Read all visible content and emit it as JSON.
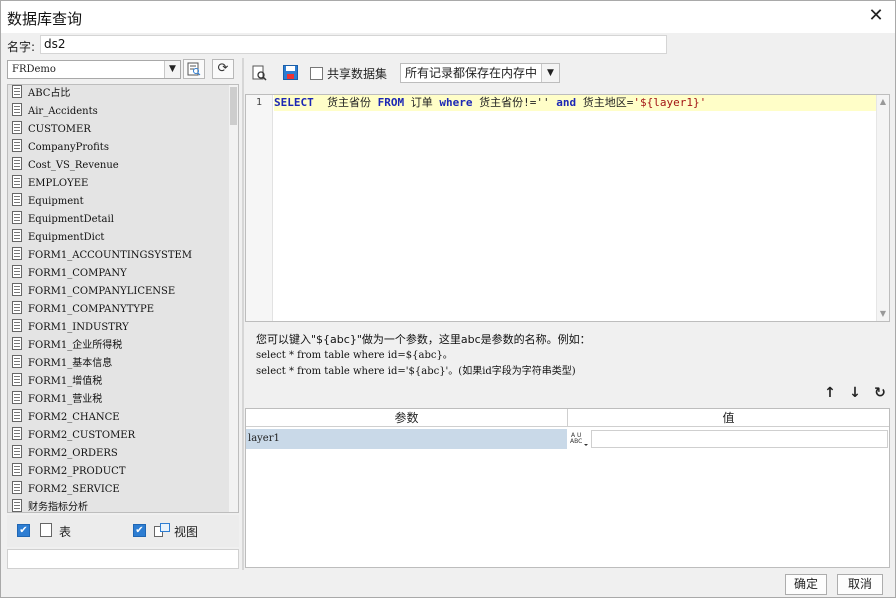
{
  "window": {
    "title": "数据库查询",
    "close_glyph": "✕"
  },
  "name_field": {
    "label": "名字:",
    "value": "ds2"
  },
  "left": {
    "database": "FRDemo",
    "tables": [
      "ABC占比",
      "Air_Accidents",
      "CUSTOMER",
      "CompanyProfits",
      "Cost_VS_Revenue",
      "EMPLOYEE",
      "Equipment",
      "EquipmentDetail",
      "EquipmentDict",
      "FORM1_ACCOUNTINGSYSTEM",
      "FORM1_COMPANY",
      "FORM1_COMPANYLICENSE",
      "FORM1_COMPANYTYPE",
      "FORM1_INDUSTRY",
      "FORM1_企业所得税",
      "FORM1_基本信息",
      "FORM1_增值税",
      "FORM1_营业税",
      "FORM2_CHANCE",
      "FORM2_CUSTOMER",
      "FORM2_ORDERS",
      "FORM2_PRODUCT",
      "FORM2_SERVICE",
      "财务指标分析"
    ],
    "check_table_label": "表",
    "check_view_label": "视图"
  },
  "right": {
    "share_label": "共享数据集",
    "memory_option": "所有记录都保存在内存中",
    "sql": {
      "line_number": "1",
      "kw_select": "SELECT",
      "t1": "  货主省份 ",
      "kw_from": "FROM",
      "t2": " 订单 ",
      "kw_where": "where",
      "t3": " 货主省份!=''",
      "t3b": " ",
      "kw_and": "and",
      "t4": " 货主地区=",
      "str_param": "'${layer1}'"
    },
    "hint": {
      "line1": "您可以键入\"${abc}\"做为一个参数，这里abc是参数的名称。例如：",
      "line2": "select * from table where id=${abc}。",
      "line3": "select * from table where id='${abc}'。(如果id字段为字符串类型)"
    },
    "params": {
      "col_name": "参数",
      "col_value": "值",
      "rows": [
        {
          "name": "layer1",
          "type_icon": "A-U ABC",
          "value": ""
        }
      ]
    }
  },
  "footer": {
    "ok_label": "确定",
    "cancel_label": "取消"
  }
}
